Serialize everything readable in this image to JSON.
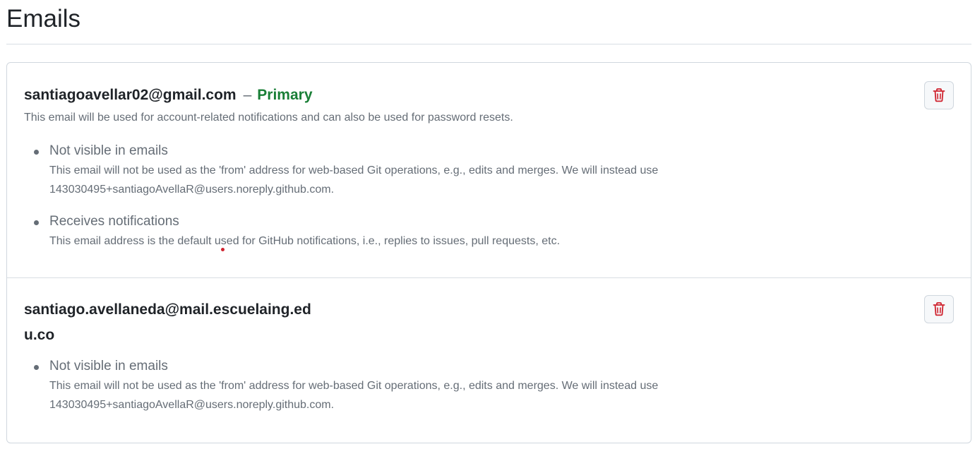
{
  "page": {
    "title": "Emails"
  },
  "emails": [
    {
      "address": "santiagoavellar02@gmail.com",
      "separator": "–",
      "badge": "Primary",
      "description": "This email will be used for account-related notifications and can also be used for password resets.",
      "properties": [
        {
          "title": "Not visible in emails",
          "description": "This email will not be used as the 'from' address for web-based Git operations, e.g., edits and merges. We will instead use 143030495+santiagoAvellaR@users.noreply.github.com."
        },
        {
          "title": "Receives notifications",
          "description": "This email address is the default used for GitHub notifications, i.e., replies to issues, pull requests, etc."
        }
      ],
      "delete_icon": "trash-icon"
    },
    {
      "address_line1": "santiago.avellaneda@mail.escuelaing.ed",
      "address_line2": "u.co",
      "properties": [
        {
          "title": "Not visible in emails",
          "description": "This email will not be used as the 'from' address for web-based Git operations, e.g., edits and merges. We will instead use 143030495+santiagoAvellaR@users.noreply.github.com."
        }
      ],
      "delete_icon": "trash-icon"
    }
  ],
  "colors": {
    "primary_badge": "#1a7f37",
    "delete_icon": "#cf222e",
    "muted_text": "#656d76",
    "border": "#d0d7de"
  }
}
